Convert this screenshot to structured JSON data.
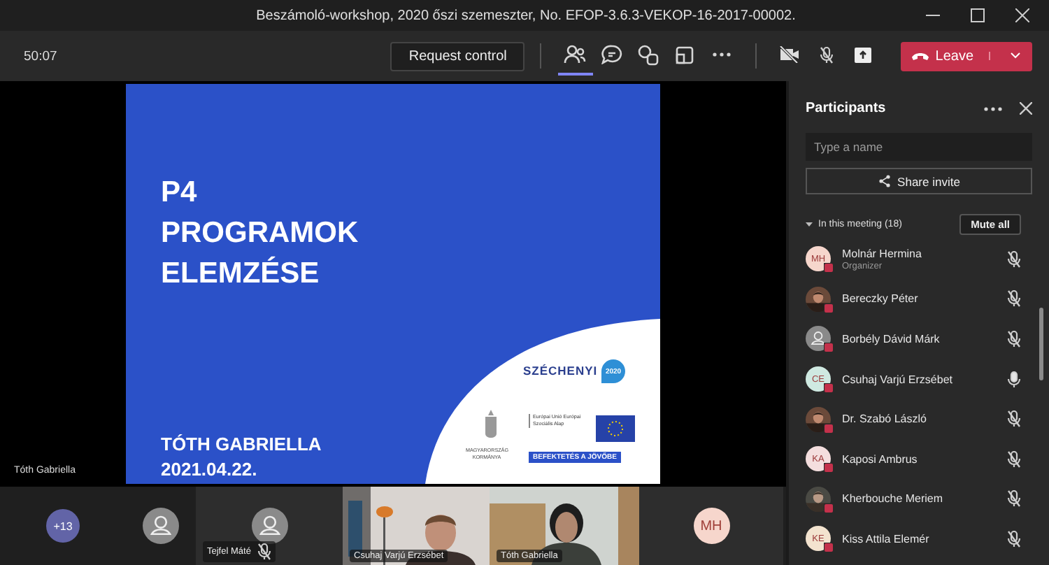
{
  "window": {
    "title": "Beszámoló-workshop, 2020 őszi szemeszter, No. EFOP-3.6.3-VEKOP-16-2017-00002."
  },
  "toolbar": {
    "timer": "50:07",
    "request_control": "Request control",
    "tools": [
      {
        "kind": "people",
        "selected": true
      },
      {
        "kind": "chat",
        "selected": false
      },
      {
        "kind": "reactions",
        "selected": false
      },
      {
        "kind": "rooms",
        "selected": false
      },
      {
        "kind": "more",
        "selected": false
      }
    ],
    "camera_on": false,
    "mic_on": false,
    "leave": "Leave"
  },
  "slide": {
    "lines": [
      "P4",
      "PROGRAMOK",
      "ELEMZÉSE"
    ],
    "author": "TÓTH GABRIELLA",
    "date": "2021.04.22.",
    "szechenyi": "SZÉCHENYI",
    "szechenyi_year": "2020",
    "eu_text": "Európai Unió Európai Szociális Alap",
    "government": "MAGYARORSZÁG KORMÁNYA",
    "slogan": "BEFEKTETÉS A JÖVŐBE"
  },
  "presenter_label": "Tóth Gabriella",
  "video_strip": [
    {
      "kind": "overflow",
      "count": "+13"
    },
    {
      "kind": "avatar"
    },
    {
      "kind": "avatar",
      "name": "Tejfel Máté",
      "muted": true
    },
    {
      "kind": "video",
      "name": "Csuhaj Varjú Erzsébet"
    },
    {
      "kind": "video",
      "name": "Tóth Gabriella"
    },
    {
      "kind": "initials",
      "initials": "MH",
      "color": "#f6d6cc"
    }
  ],
  "participants": {
    "title": "Participants",
    "search_placeholder": "Type a name",
    "share_invite": "Share invite",
    "section": "In this meeting (18)",
    "expanded": true,
    "mute_all": "Mute all",
    "people": [
      {
        "name": "Molnár Hermina",
        "role": "Organizer",
        "kind": "initials",
        "initials": "MH",
        "color": "#f6d6cc",
        "muted": true
      },
      {
        "name": "Bereczky Péter",
        "muted": true
      },
      {
        "name": "Borbély Dávid Márk",
        "kind": "default",
        "muted": true
      },
      {
        "name": "Csuhaj Varjú Erzsébet",
        "kind": "initials",
        "initials": "CE",
        "color": "#cfe9e1",
        "muted": false
      },
      {
        "name": "Dr. Szabó László",
        "muted": true
      },
      {
        "name": "Kaposi Ambrus",
        "kind": "initials",
        "initials": "KA",
        "color": "#f4dede",
        "muted": true
      },
      {
        "name": "Kherbouche Meriem",
        "muted": true
      },
      {
        "name": "Kiss Attila Elemér",
        "kind": "initials",
        "initials": "KE",
        "color": "#f3e3cf",
        "muted": true
      }
    ]
  }
}
